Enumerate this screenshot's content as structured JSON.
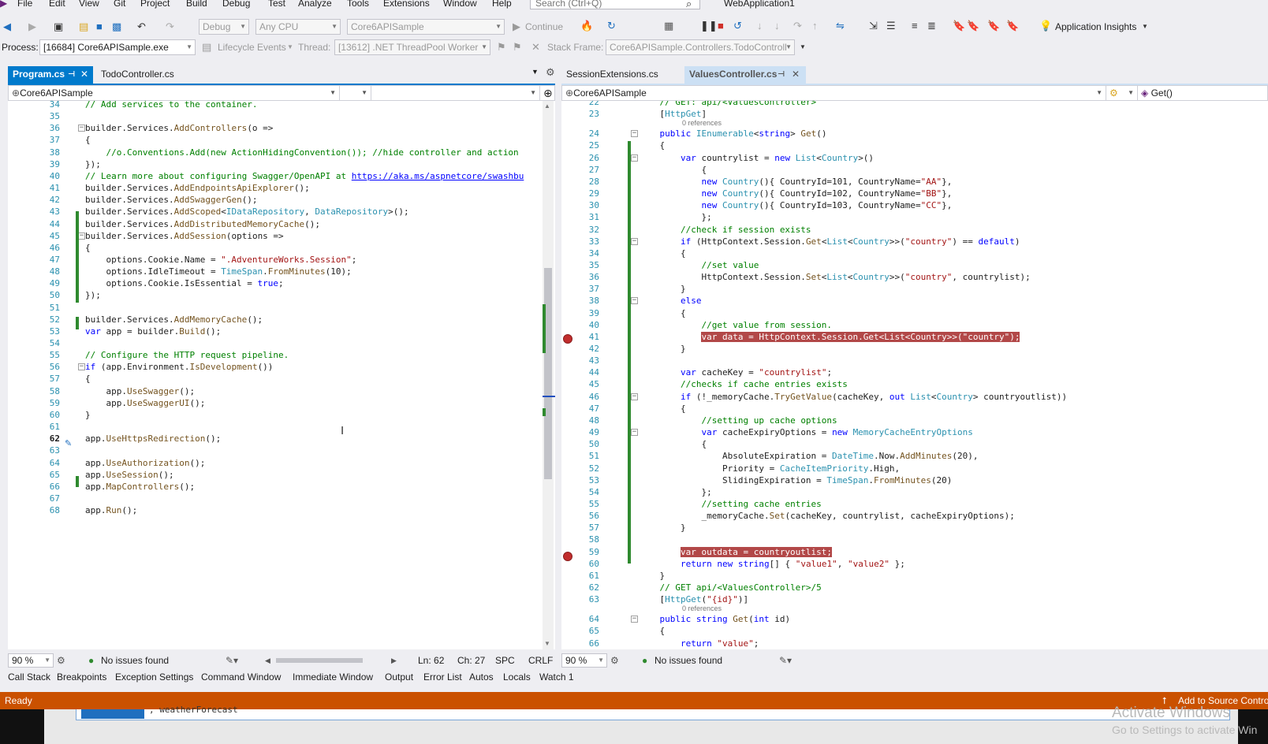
{
  "menu": [
    "File",
    "Edit",
    "View",
    "Git",
    "Project",
    "Build",
    "Debug",
    "Test",
    "Analyze",
    "Tools",
    "Extensions",
    "Window",
    "Help"
  ],
  "search": {
    "placeholder": "Search (Ctrl+Q)"
  },
  "window_title": "WebApplication1",
  "toolbar": {
    "config": "Debug",
    "platform": "Any CPU",
    "startup_project": "Core6APISample",
    "continue_label": "Continue",
    "app_insights": "Application Insights"
  },
  "debug_location": {
    "process_label": "Process:",
    "process": "[16684] Core6APISample.exe",
    "lifecycle": "Lifecycle Events",
    "thread_label": "Thread:",
    "thread": "[13612] .NET ThreadPool Worker",
    "stackframe_label": "Stack Frame:",
    "stackframe": "Core6APISample.Controllers.TodoControll"
  },
  "left_editor": {
    "tabs": [
      "Program.cs",
      "TodoController.cs"
    ],
    "nav_project": "Core6APISample",
    "zoom": "90 %",
    "issues": "No issues found",
    "ln": "Ln: 62",
    "ch": "Ch: 27",
    "spc": "SPC",
    "eol": "CRLF",
    "lines": [
      {
        "n": "34",
        "code": "<span class='c-com'>// Add services to the container.</span>"
      },
      {
        "n": "35",
        "code": ""
      },
      {
        "n": "36",
        "code": "builder.Services.<span class='c-mth'>AddControllers</span>(o =&gt;"
      },
      {
        "n": "37",
        "code": "{"
      },
      {
        "n": "38",
        "code": "    <span class='c-com'>//o.Conventions.Add(new ActionHidingConvention()); //hide controller and action</span>"
      },
      {
        "n": "39",
        "code": "});"
      },
      {
        "n": "40",
        "code": "<span class='c-com'>// Learn more about configuring Swagger/OpenAPI at </span><span class='c-link'>https://aka.ms/aspnetcore/swashbu</span>"
      },
      {
        "n": "41",
        "code": "builder.Services.<span class='c-mth'>AddEndpointsApiExplorer</span>();"
      },
      {
        "n": "42",
        "code": "builder.Services.<span class='c-mth'>AddSwaggerGen</span>();"
      },
      {
        "n": "43",
        "code": "builder.Services.<span class='c-mth'>AddScoped</span>&lt;<span class='c-ty'>IDataRepository</span>, <span class='c-ty'>DataRepository</span>&gt;();"
      },
      {
        "n": "44",
        "code": "builder.Services.<span class='c-mth'>AddDistributedMemoryCache</span>();"
      },
      {
        "n": "45",
        "code": "builder.Services.<span class='c-mth'>AddSession</span>(options =&gt;"
      },
      {
        "n": "46",
        "code": "{"
      },
      {
        "n": "47",
        "code": "    options.Cookie.Name = <span class='c-str'>\".AdventureWorks.Session\"</span>;"
      },
      {
        "n": "48",
        "code": "    options.IdleTimeout = <span class='c-ty'>TimeSpan</span>.<span class='c-mth'>FromMinutes</span>(10);"
      },
      {
        "n": "49",
        "code": "    options.Cookie.IsEssential = <span class='c-kw'>true</span>;"
      },
      {
        "n": "50",
        "code": "});"
      },
      {
        "n": "51",
        "code": ""
      },
      {
        "n": "52",
        "code": "builder.Services.<span class='c-mth'>AddMemoryCache</span>();"
      },
      {
        "n": "53",
        "code": "<span class='c-kw'>var</span> app = builder.<span class='c-mth'>Build</span>();"
      },
      {
        "n": "54",
        "code": ""
      },
      {
        "n": "55",
        "code": "<span class='c-com'>// Configure the HTTP request pipeline.</span>"
      },
      {
        "n": "56",
        "code": "<span class='c-kw'>if</span> (app.Environment.<span class='c-mth'>IsDevelopment</span>())"
      },
      {
        "n": "57",
        "code": "{"
      },
      {
        "n": "58",
        "code": "    app.<span class='c-mth'>UseSwagger</span>();"
      },
      {
        "n": "59",
        "code": "    app.<span class='c-mth'>UseSwaggerUI</span>();"
      },
      {
        "n": "60",
        "code": "}"
      },
      {
        "n": "61",
        "code": ""
      },
      {
        "n": "62",
        "code": "app.<span class='c-mth'>UseHttpsRedirection</span>();"
      },
      {
        "n": "63",
        "code": ""
      },
      {
        "n": "64",
        "code": "app.<span class='c-mth'>UseAuthorization</span>();"
      },
      {
        "n": "65",
        "code": "app.<span class='c-mth'>UseSession</span>();"
      },
      {
        "n": "66",
        "code": "app.<span class='c-mth'>MapControllers</span>();"
      },
      {
        "n": "67",
        "code": ""
      },
      {
        "n": "68",
        "code": "app.<span class='c-mth'>Run</span>();"
      }
    ]
  },
  "right_editor": {
    "tabs": [
      "SessionExtensions.cs",
      "ValuesController.cs"
    ],
    "nav_project": "Core6APISample",
    "nav_member": "Get()",
    "zoom": "90 %",
    "issues": "No issues found",
    "references": "0 references",
    "lines": [
      {
        "n": "22",
        "code": "    <span class='c-com'>// GET: api/&lt;ValuesController&gt;</span>"
      },
      {
        "n": "23",
        "code": "    [<span class='c-ty'>HttpGet</span>]"
      },
      {
        "n": "24",
        "code": "    <span class='c-kw'>public</span> <span class='c-ty'>IEnumerable</span>&lt;<span class='c-kw'>string</span>&gt; <span class='c-mth'>Get</span>()"
      },
      {
        "n": "25",
        "code": "    {"
      },
      {
        "n": "26",
        "code": "        <span class='c-kw'>var</span> countrylist = <span class='c-kw'>new</span> <span class='c-ty'>List</span>&lt;<span class='c-ty'>Country</span>&gt;()"
      },
      {
        "n": "27",
        "code": "            {"
      },
      {
        "n": "28",
        "code": "            <span class='c-kw'>new</span> <span class='c-ty'>Country</span>(){ CountryId=101, CountryName=<span class='c-str'>\"AA\"</span>},"
      },
      {
        "n": "29",
        "code": "            <span class='c-kw'>new</span> <span class='c-ty'>Country</span>(){ CountryId=102, CountryName=<span class='c-str'>\"BB\"</span>},"
      },
      {
        "n": "30",
        "code": "            <span class='c-kw'>new</span> <span class='c-ty'>Country</span>(){ CountryId=103, CountryName=<span class='c-str'>\"CC\"</span>},"
      },
      {
        "n": "31",
        "code": "            };"
      },
      {
        "n": "32",
        "code": "        <span class='c-com'>//check if session exists</span>"
      },
      {
        "n": "33",
        "code": "        <span class='c-kw'>if</span> (HttpContext.Session.<span class='c-mth'>Get</span>&lt;<span class='c-ty'>List</span>&lt;<span class='c-ty'>Country</span>&gt;&gt;(<span class='c-str'>\"country\"</span>) == <span class='c-kw'>default</span>)"
      },
      {
        "n": "34",
        "code": "        {"
      },
      {
        "n": "35",
        "code": "            <span class='c-com'>//set value</span>"
      },
      {
        "n": "36",
        "code": "            HttpContext.Session.<span class='c-mth'>Set</span>&lt;<span class='c-ty'>List</span>&lt;<span class='c-ty'>Country</span>&gt;&gt;(<span class='c-str'>\"country\"</span>, countrylist);"
      },
      {
        "n": "37",
        "code": "        }"
      },
      {
        "n": "38",
        "code": "        <span class='c-kw'>else</span>"
      },
      {
        "n": "39",
        "code": "        {"
      },
      {
        "n": "40",
        "code": "            <span class='c-com'>//get value from session.</span>"
      },
      {
        "n": "41",
        "code": "            <span class='bphl'>var data = HttpContext.Session.Get&lt;List&lt;Country&gt;&gt;(\"country\");</span>"
      },
      {
        "n": "42",
        "code": "        }"
      },
      {
        "n": "43",
        "code": ""
      },
      {
        "n": "44",
        "code": "        <span class='c-kw'>var</span> cacheKey = <span class='c-str'>\"countrylist\"</span>;"
      },
      {
        "n": "45",
        "code": "        <span class='c-com'>//checks if cache entries exists</span>"
      },
      {
        "n": "46",
        "code": "        <span class='c-kw'>if</span> (!_memoryCache.<span class='c-mth'>TryGetValue</span>(cacheKey, <span class='c-kw'>out</span> <span class='c-ty'>List</span>&lt;<span class='c-ty'>Country</span>&gt; countryoutlist))"
      },
      {
        "n": "47",
        "code": "        {"
      },
      {
        "n": "48",
        "code": "            <span class='c-com'>//setting up cache options</span>"
      },
      {
        "n": "49",
        "code": "            <span class='c-kw'>var</span> cacheExpiryOptions = <span class='c-kw'>new</span> <span class='c-ty'>MemoryCacheEntryOptions</span>"
      },
      {
        "n": "50",
        "code": "            {"
      },
      {
        "n": "51",
        "code": "                AbsoluteExpiration = <span class='c-ty'>DateTime</span>.Now.<span class='c-mth'>AddMinutes</span>(20),"
      },
      {
        "n": "52",
        "code": "                Priority = <span class='c-ty'>CacheItemPriority</span>.High,"
      },
      {
        "n": "53",
        "code": "                SlidingExpiration = <span class='c-ty'>TimeSpan</span>.<span class='c-mth'>FromMinutes</span>(20)"
      },
      {
        "n": "54",
        "code": "            };"
      },
      {
        "n": "55",
        "code": "            <span class='c-com'>//setting cache entries</span>"
      },
      {
        "n": "56",
        "code": "            _memoryCache.<span class='c-mth'>Set</span>(cacheKey, countrylist, cacheExpiryOptions);"
      },
      {
        "n": "57",
        "code": "        }"
      },
      {
        "n": "58",
        "code": ""
      },
      {
        "n": "59",
        "code": "        <span class='bphl'>var outdata = countryoutlist;</span>"
      },
      {
        "n": "60",
        "code": "        <span class='c-kw'>return</span> <span class='c-kw'>new</span> <span class='c-kw'>string</span>[] { <span class='c-str'>\"value1\"</span>, <span class='c-str'>\"value2\"</span> };"
      },
      {
        "n": "61",
        "code": "    }"
      },
      {
        "n": "62",
        "code": "    <span class='c-com'>// GET api/&lt;ValuesController&gt;/5</span>"
      },
      {
        "n": "63",
        "code": "    [<span class='c-ty'>HttpGet</span>(<span class='c-str'>\"{id}\"</span>)]"
      },
      {
        "n": "64",
        "code": "    <span class='c-kw'>public</span> <span class='c-kw'>string</span> <span class='c-mth'>Get</span>(<span class='c-kw'>int</span> id)"
      },
      {
        "n": "65",
        "code": "    {"
      },
      {
        "n": "66",
        "code": "        <span class='c-kw'>return</span> <span class='c-str'>\"value\"</span>;"
      }
    ]
  },
  "tool_windows": [
    "Call Stack",
    "Breakpoints",
    "Exception Settings",
    "Command Window",
    "Immediate Window",
    "Output",
    "Error List",
    "Autos",
    "Locals",
    "Watch 1"
  ],
  "status": {
    "text": "Ready",
    "source_control": "Add to Source Contro"
  },
  "background_text": ", weatherForecast",
  "activate": {
    "title": "Activate Windows",
    "subtitle": "Go to Settings to activate Win"
  },
  "colors": {
    "accent": "#007acc",
    "status_bar": "#ca5100",
    "breakpoint": "#c12d2d",
    "change_bar": "#2f8a2f"
  },
  "icons": [
    "back-icon",
    "forward-icon",
    "new-item-icon",
    "open-folder-icon",
    "save-icon",
    "save-all-icon",
    "undo-icon",
    "redo-icon",
    "play-icon",
    "hot-reload-icon",
    "restart-icon",
    "pause-icon",
    "stop-icon",
    "step-icon",
    "breakpoint-icon",
    "pin-icon",
    "close-icon",
    "gear-icon",
    "split-icon",
    "lightbulb-icon",
    "search-icon",
    "no-issues-icon",
    "brush-icon"
  ]
}
